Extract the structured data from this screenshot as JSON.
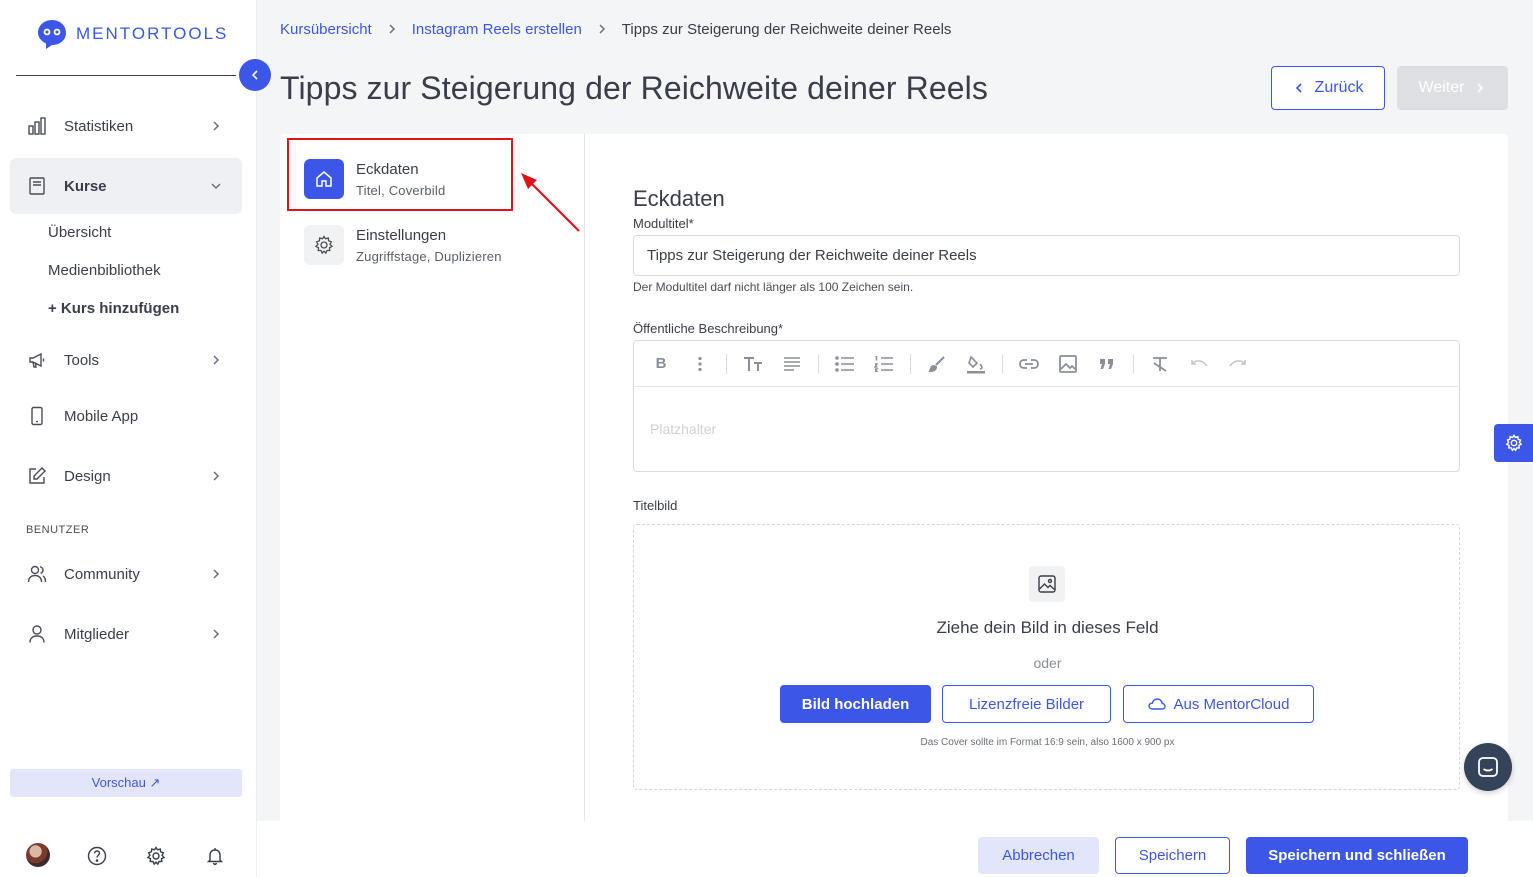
{
  "brand": {
    "logo_text": "MENTORTOOLS"
  },
  "sidebar": {
    "items": [
      {
        "label": "Statistiken",
        "icon": "bar-chart-icon"
      },
      {
        "label": "Kurse",
        "icon": "book-icon"
      },
      {
        "label": "Tools",
        "icon": "megaphone-icon"
      },
      {
        "label": "Mobile App",
        "icon": "phone-icon"
      },
      {
        "label": "Design",
        "icon": "pencil-icon"
      },
      {
        "label": "Community",
        "icon": "users-icon"
      },
      {
        "label": "Mitglieder",
        "icon": "user-icon"
      }
    ],
    "sub_items": [
      {
        "label": "Übersicht"
      },
      {
        "label": "Medienbibliothek"
      },
      {
        "label": "+ Kurs hinzufügen"
      }
    ],
    "section_label": "BENUTZER",
    "preview_label": "Vorschau ↗"
  },
  "breadcrumb": {
    "items": [
      "Kursübersicht",
      "Instagram Reels erstellen"
    ],
    "current": "Tipps zur Steigerung der Reichweite deiner Reels"
  },
  "page": {
    "title": "Tipps zur Steigerung der Reichweite deiner Reels",
    "back_label": "Zurück",
    "next_label": "Weiter"
  },
  "steps": [
    {
      "title": "Eckdaten",
      "subtitle": "Titel, Coverbild"
    },
    {
      "title": "Einstellungen",
      "subtitle": "Zugriffstage, Duplizieren"
    }
  ],
  "form": {
    "title": "Eckdaten",
    "module_title_label": "Modultitel*",
    "module_title_value": "Tipps zur Steigerung der Reichweite deiner Reels",
    "module_title_hint": "Der Modultitel darf nicht länger als 100 Zeichen sein.",
    "description_label": "Öffentliche Beschreibung*",
    "description_placeholder": "Platzhalter",
    "cover_label": "Titelbild",
    "dropzone_title": "Ziehe dein Bild in dieses Feld",
    "dropzone_or": "oder",
    "upload_label": "Bild hochladen",
    "free_images_label": "Lizenzfreie Bilder",
    "cloud_label": "Aus MentorCloud",
    "cover_note": "Das Cover sollte im Format 16:9 sein, also 1600 x 900 px"
  },
  "footer": {
    "cancel_label": "Abbrechen",
    "save_label": "Speichern",
    "save_close_label": "Speichern und schließen"
  },
  "colors": {
    "accent": "#3c57e8",
    "highlight": "#e0131b"
  }
}
